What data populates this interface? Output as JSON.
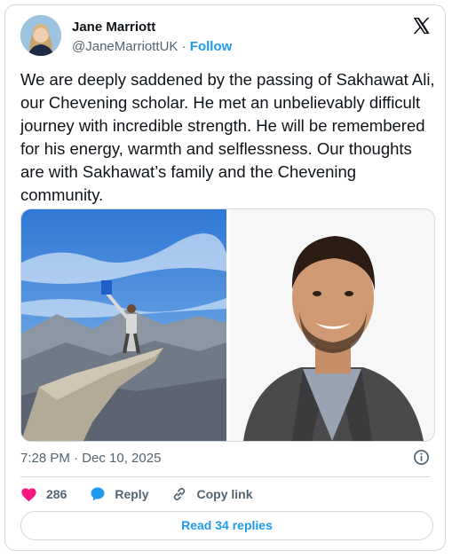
{
  "author": {
    "name": "Jane Marriott",
    "handle": "@JaneMarriottUK",
    "separator": "·",
    "follow_label": "Follow"
  },
  "tweet": {
    "text": "We are deeply saddened by the passing of Sakhawat Ali, our Chevening scholar. He met an unbelievably difficult journey with incredible strength. He will be remembered for his energy, warmth and selflessness. Our thoughts are with Sakhawat’s family and the Chevening community."
  },
  "media": [
    {
      "icon": "photo-man-on-rock-cliff"
    },
    {
      "icon": "photo-portrait-smiling-man"
    }
  ],
  "meta": {
    "timestamp": "7:28 PM · Dec 10, 2025"
  },
  "actions": {
    "likes_count": "286",
    "reply_label": "Reply",
    "copy_link_label": "Copy link"
  },
  "read_replies_label": "Read 34 replies",
  "colors": {
    "accent": "#1d9bf0",
    "like": "#f91880",
    "text": "#0f1419",
    "muted": "#536471",
    "border": "#cfd9de"
  }
}
